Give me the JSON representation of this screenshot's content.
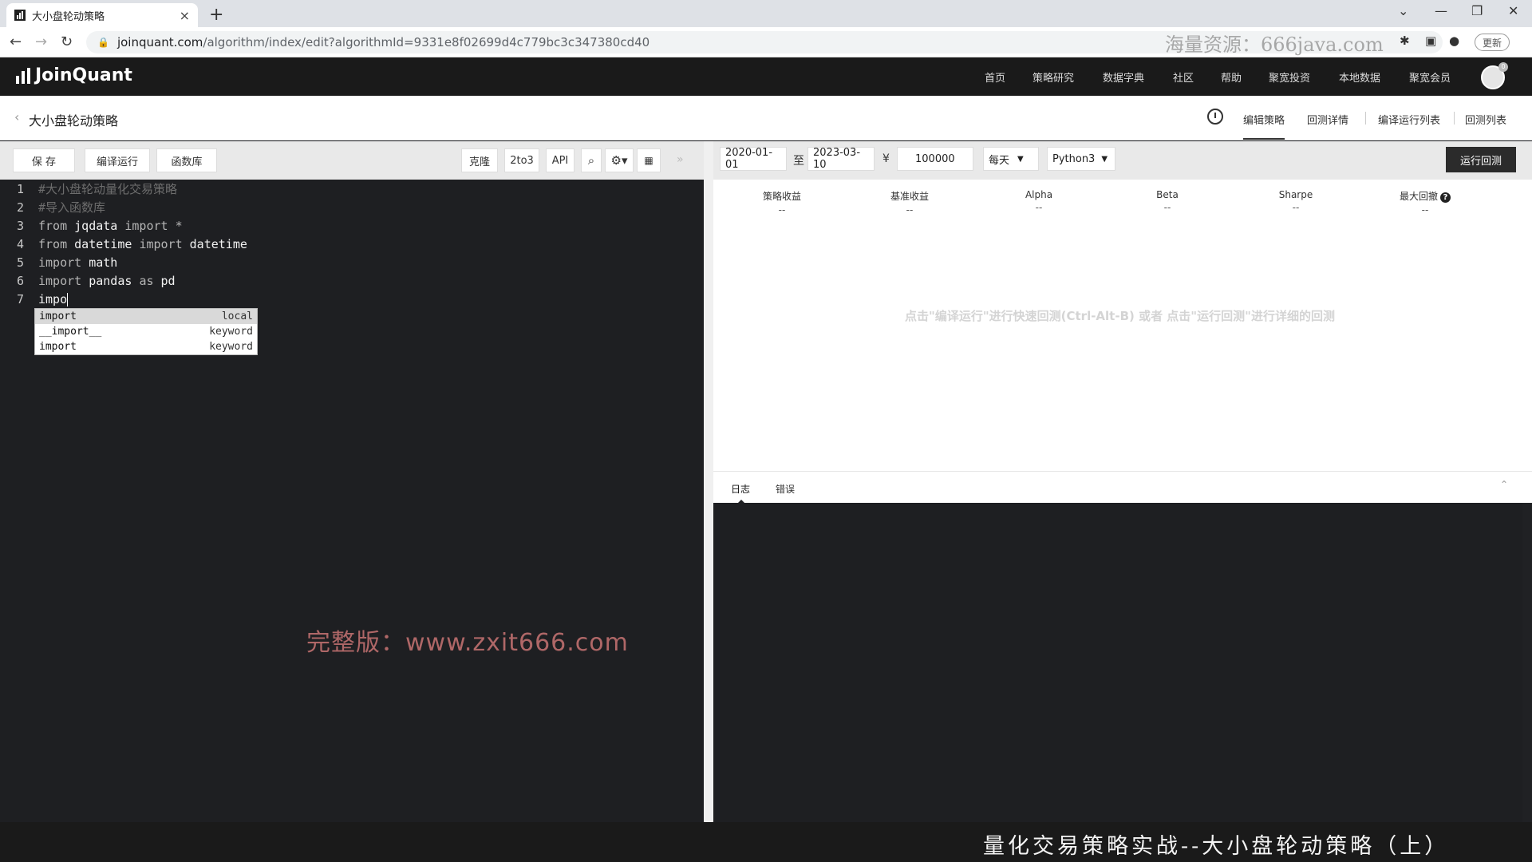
{
  "browser": {
    "tab_title": "大小盘轮动策略",
    "tab_close": "×",
    "new_tab": "+",
    "url_host": "joinquant.com",
    "url_path": "/algorithm/index/edit?algorithmId=9331e8f02699d4c779bc3c347380cd40",
    "update_label": "更新",
    "watermark": "海量资源：666java.com"
  },
  "header": {
    "logo": "JoinQuant",
    "nav": [
      "首页",
      "策略研究",
      "数据字典",
      "社区",
      "帮助",
      "聚宽投资",
      "本地数据",
      "聚宽会员"
    ],
    "avatar_badge": "0"
  },
  "subheader": {
    "title": "大小盘轮动策略",
    "tabs": [
      "编辑策略",
      "回测详情",
      "编译运行列表",
      "回测列表"
    ]
  },
  "editor_toolbar": {
    "save": "保 存",
    "compile_run": "编译运行",
    "function_lib": "函数库",
    "clone": "克隆",
    "to3": "2to3",
    "api": "API",
    "expand": "»"
  },
  "code": {
    "lines": [
      {
        "n": "1"
      },
      {
        "n": "2"
      },
      {
        "n": "3"
      },
      {
        "n": "4"
      },
      {
        "n": "5"
      },
      {
        "n": "6"
      },
      {
        "n": "7"
      }
    ],
    "l1": "#大小盘轮动量化交易策略",
    "l2": "#导入函数库",
    "from": "from",
    "import": "import",
    "as": "as",
    "jqdata": "jqdata",
    "star": "*",
    "datetime": "datetime",
    "math": "math",
    "pandas": "pandas",
    "pd": "pd",
    "typed": "impo"
  },
  "autocomplete": [
    {
      "label": "import",
      "type": "local"
    },
    {
      "label": "__import__",
      "type": "keyword"
    },
    {
      "label": "import",
      "type": "keyword"
    }
  ],
  "watermark_center": "完整版：www.zxit666.com",
  "backtest": {
    "start_date": "2020-01-01",
    "to": "至",
    "end_date": "2023-03-10",
    "currency": "¥",
    "capital": "100000",
    "frequency": "每天",
    "python": "Python3",
    "run_label": "运行回测"
  },
  "metrics": [
    {
      "label": "策略收益",
      "value": "--"
    },
    {
      "label": "基准收益",
      "value": "--"
    },
    {
      "label": "Alpha",
      "value": "--"
    },
    {
      "label": "Beta",
      "value": "--"
    },
    {
      "label": "Sharpe",
      "value": "--"
    },
    {
      "label": "最大回撤",
      "value": "--"
    }
  ],
  "hint": "点击\"编译运行\"进行快速回测(Ctrl-Alt-B) 或者 点击\"运行回测\"进行详细的回测",
  "log_tabs": [
    "日志",
    "错误"
  ],
  "bottom_watermark": "量化交易策略实战--大小盘轮动策略（上）"
}
